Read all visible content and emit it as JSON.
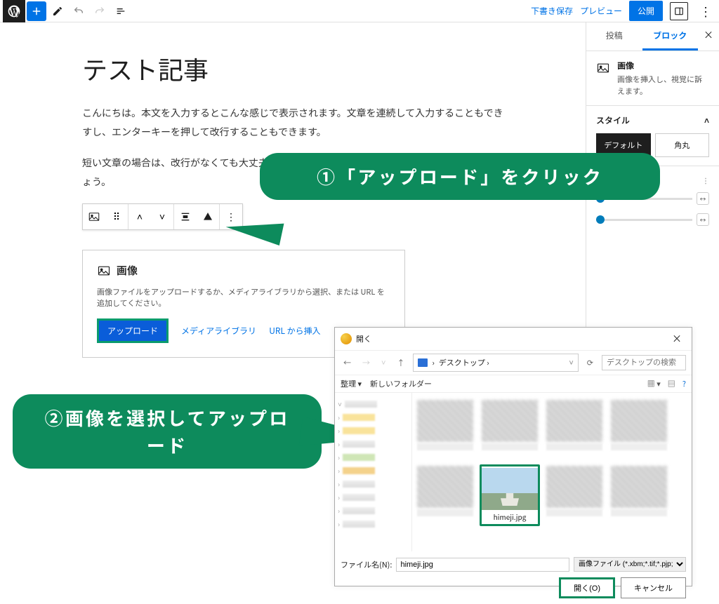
{
  "topbar": {
    "draft_save": "下書き保存",
    "preview": "プレビュー",
    "publish": "公開"
  },
  "editor": {
    "title": "テスト記事",
    "p1": "こんにちは。本文を入力するとこんな感じで表示されます。文章を連続して入力することもできすし、エンターキーを押して改行することもできます。",
    "p2": "短い文章の場合は、改行がなくても大丈夫ですが、長い文章の場合は改行したほうがいいでしょう。",
    "image_block": {
      "title": "画像",
      "desc": "画像ファイルをアップロードするか、メディアライブラリから選択、または URL を追加してください。",
      "upload": "アップロード",
      "media": "メディアライブラリ",
      "url": "URL から挿入"
    }
  },
  "sidebar": {
    "tab_post": "投稿",
    "tab_block": "ブロック",
    "block_info_title": "画像",
    "block_info_desc": "画像を挿入し、視覚に訴えます。",
    "style_heading": "スタイル",
    "style_default": "デフォルト",
    "style_rounded": "角丸"
  },
  "callouts": {
    "c1": "①「アップロード」をクリック",
    "c2": "②画像を選択してアップロード"
  },
  "dialog": {
    "title": "開く",
    "path_label": "デスクトップ ›",
    "search_placeholder": "デスクトップの検索",
    "organize": "整理 ▾",
    "newfolder": "新しいフォルダー",
    "selected_file": "himeji.jpg",
    "filename_label": "ファイル名(N):",
    "filename_value": "himeji.jpg",
    "filetype": "画像ファイル (*.xbm;*.tif;*.pjp;*.a",
    "open": "開く(O)",
    "cancel": "キャンセル"
  }
}
